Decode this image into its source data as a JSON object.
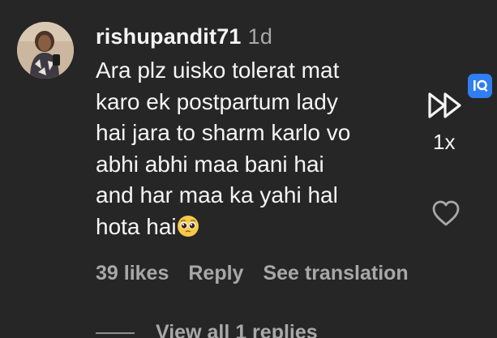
{
  "comment": {
    "username": "rishupandit71",
    "timestamp": "1d",
    "text": "Ara plz uisko tolerat mat\nkaro ek postpartum lady\nhai jara to sharm karlo vo\nabhi abhi maa bani hai\nand har maa ka yahi hal\nhota hai",
    "emoji": "pleading-face-emoji"
  },
  "actions": {
    "likes": "39 likes",
    "reply": "Reply",
    "translation": "See translation"
  },
  "replies": {
    "label": "View all 1 replies"
  },
  "player": {
    "speed": "1x"
  },
  "colors": {
    "background": "#262626",
    "primary_text": "#f5f5f5",
    "secondary_text": "#a8a8a8",
    "badge": "#2f7ef2"
  }
}
